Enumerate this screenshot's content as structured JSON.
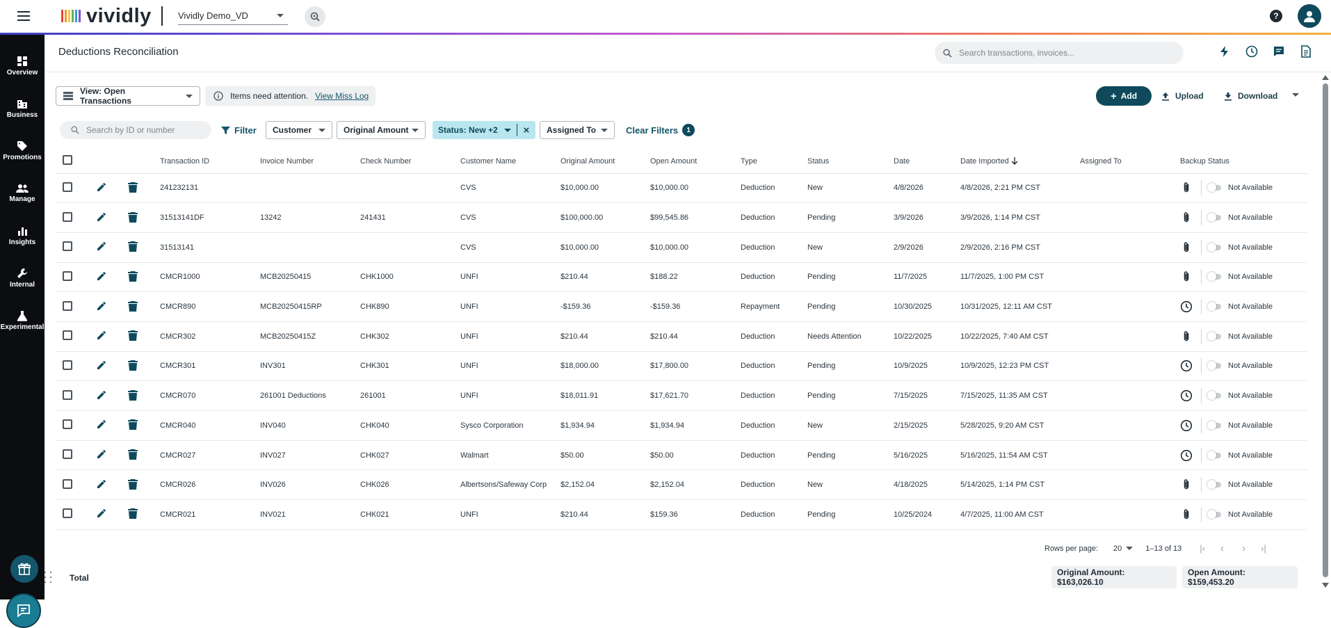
{
  "app": {
    "logo": "vividly",
    "tenant": "Vividly Demo_VD",
    "brand_colors": [
      "#e9463f",
      "#f29a2e",
      "#f5c84a",
      "#58b85c",
      "#3a9ad9",
      "#7a4fd6"
    ],
    "accent": "#0e4a5c"
  },
  "sidenav": {
    "items": [
      {
        "label": "Overview",
        "icon": "dashboard-icon"
      },
      {
        "label": "Business",
        "icon": "building-icon"
      },
      {
        "label": "Promotions",
        "icon": "tag-icon"
      },
      {
        "label": "Manage",
        "icon": "people-icon"
      },
      {
        "label": "Insights",
        "icon": "bar-chart-icon"
      },
      {
        "label": "Internal",
        "icon": "wrench-icon"
      },
      {
        "label": "Experimental",
        "icon": "flask-icon"
      }
    ]
  },
  "header": {
    "title": "Deductions Reconciliation",
    "search_placeholder": "Search transactions, invoices..."
  },
  "toolbar": {
    "view_label": "View: Open Transactions",
    "attention_text": "Items need attention.",
    "attention_link": "View Miss Log",
    "add_label": "Add",
    "upload_label": "Upload",
    "download_label": "Download"
  },
  "filters": {
    "search_placeholder": "Search by ID or number",
    "filter_label": "Filter",
    "chips": [
      "Customer",
      "Original Amount",
      "Assigned To"
    ],
    "active_chip": "Status: New +2",
    "clear_label": "Clear Filters",
    "clear_count": "1"
  },
  "table": {
    "columns": [
      "Transaction ID",
      "Invoice Number",
      "Check Number",
      "Customer Name",
      "Original Amount",
      "Open Amount",
      "Type",
      "Status",
      "Date",
      "Date Imported",
      "Assigned To",
      "Backup Status"
    ],
    "rows": [
      {
        "id": "241232131",
        "invoice": "",
        "check": "",
        "customer": "CVS",
        "original": "$10,000.00",
        "open": "$10,000.00",
        "type": "Deduction",
        "status": "New",
        "date": "4/8/2026",
        "imported": "4/8/2026, 2:21 PM CST",
        "assigned": "",
        "backup_icon": "paperclip",
        "backup": "Not Available"
      },
      {
        "id": "31513141DF",
        "invoice": "13242",
        "check": "241431",
        "customer": "CVS",
        "original": "$100,000.00",
        "open": "$99,545.86",
        "type": "Deduction",
        "status": "Pending",
        "date": "3/9/2026",
        "imported": "3/9/2026, 1:14 PM CST",
        "assigned": "",
        "backup_icon": "paperclip",
        "backup": "Not Available"
      },
      {
        "id": "31513141",
        "invoice": "",
        "check": "",
        "customer": "CVS",
        "original": "$10,000.00",
        "open": "$10,000.00",
        "type": "Deduction",
        "status": "New",
        "date": "2/9/2026",
        "imported": "2/9/2026, 2:16 PM CST",
        "assigned": "",
        "backup_icon": "paperclip",
        "backup": "Not Available"
      },
      {
        "id": "CMCR1000",
        "invoice": "MCB20250415",
        "check": "CHK1000",
        "customer": "UNFI",
        "original": "$210.44",
        "open": "$188.22",
        "type": "Deduction",
        "status": "Pending",
        "date": "11/7/2025",
        "imported": "11/7/2025, 1:00 PM CST",
        "assigned": "",
        "backup_icon": "paperclip",
        "backup": "Not Available"
      },
      {
        "id": "CMCR890",
        "invoice": "MCB20250415RP",
        "check": "CHK890",
        "customer": "UNFI",
        "original": "-$159.36",
        "open": "-$159.36",
        "type": "Repayment",
        "status": "Pending",
        "date": "10/30/2025",
        "imported": "10/31/2025, 12:11 AM CST",
        "assigned": "",
        "backup_icon": "clock",
        "backup": "Not Available"
      },
      {
        "id": "CMCR302",
        "invoice": "MCB20250415Z",
        "check": "CHK302",
        "customer": "UNFI",
        "original": "$210.44",
        "open": "$210.44",
        "type": "Deduction",
        "status": "Needs Attention",
        "date": "10/22/2025",
        "imported": "10/22/2025, 7:40 AM CST",
        "assigned": "",
        "backup_icon": "paperclip",
        "backup": "Not Available"
      },
      {
        "id": "CMCR301",
        "invoice": "INV301",
        "check": "CHK301",
        "customer": "UNFI",
        "original": "$18,000.00",
        "open": "$17,800.00",
        "type": "Deduction",
        "status": "Pending",
        "date": "10/9/2025",
        "imported": "10/9/2025, 12:23 PM CST",
        "assigned": "",
        "backup_icon": "clock",
        "backup": "Not Available"
      },
      {
        "id": "CMCR070",
        "invoice": "261001 Deductions",
        "check": "261001",
        "customer": "UNFI",
        "original": "$18,011.91",
        "open": "$17,621.70",
        "type": "Deduction",
        "status": "Pending",
        "date": "7/15/2025",
        "imported": "7/15/2025, 11:35 AM CST",
        "assigned": "",
        "backup_icon": "clock",
        "backup": "Not Available"
      },
      {
        "id": "CMCR040",
        "invoice": "INV040",
        "check": "CHK040",
        "customer": "Sysco Corporation",
        "original": "$1,934.94",
        "open": "$1,934.94",
        "type": "Deduction",
        "status": "New",
        "date": "2/15/2025",
        "imported": "5/28/2025, 9:20 AM CST",
        "assigned": "",
        "backup_icon": "clock",
        "backup": "Not Available"
      },
      {
        "id": "CMCR027",
        "invoice": "INV027",
        "check": "CHK027",
        "customer": "Walmart",
        "original": "$50.00",
        "open": "$50.00",
        "type": "Deduction",
        "status": "Pending",
        "date": "5/16/2025",
        "imported": "5/16/2025, 11:54 AM CST",
        "assigned": "",
        "backup_icon": "clock",
        "backup": "Not Available"
      },
      {
        "id": "CMCR026",
        "invoice": "INV026",
        "check": "CHK026",
        "customer": "Albertsons/Safeway Corp",
        "original": "$2,152.04",
        "open": "$2,152.04",
        "type": "Deduction",
        "status": "New",
        "date": "4/18/2025",
        "imported": "5/14/2025, 1:14 PM CST",
        "assigned": "",
        "backup_icon": "paperclip",
        "backup": "Not Available"
      },
      {
        "id": "CMCR021",
        "invoice": "INV021",
        "check": "CHK021",
        "customer": "UNFI",
        "original": "$210.44",
        "open": "$159.36",
        "type": "Deduction",
        "status": "Pending",
        "date": "10/25/2024",
        "imported": "4/7/2025, 11:00 AM CST",
        "assigned": "",
        "backup_icon": "paperclip",
        "backup": "Not Available"
      }
    ]
  },
  "pagination": {
    "rows_label": "Rows per page:",
    "rows_value": "20",
    "range": "1–13 of 13"
  },
  "totals": {
    "label": "Total",
    "original": "Original Amount: $163,026.10",
    "open": "Open Amount: $159,453.20"
  }
}
